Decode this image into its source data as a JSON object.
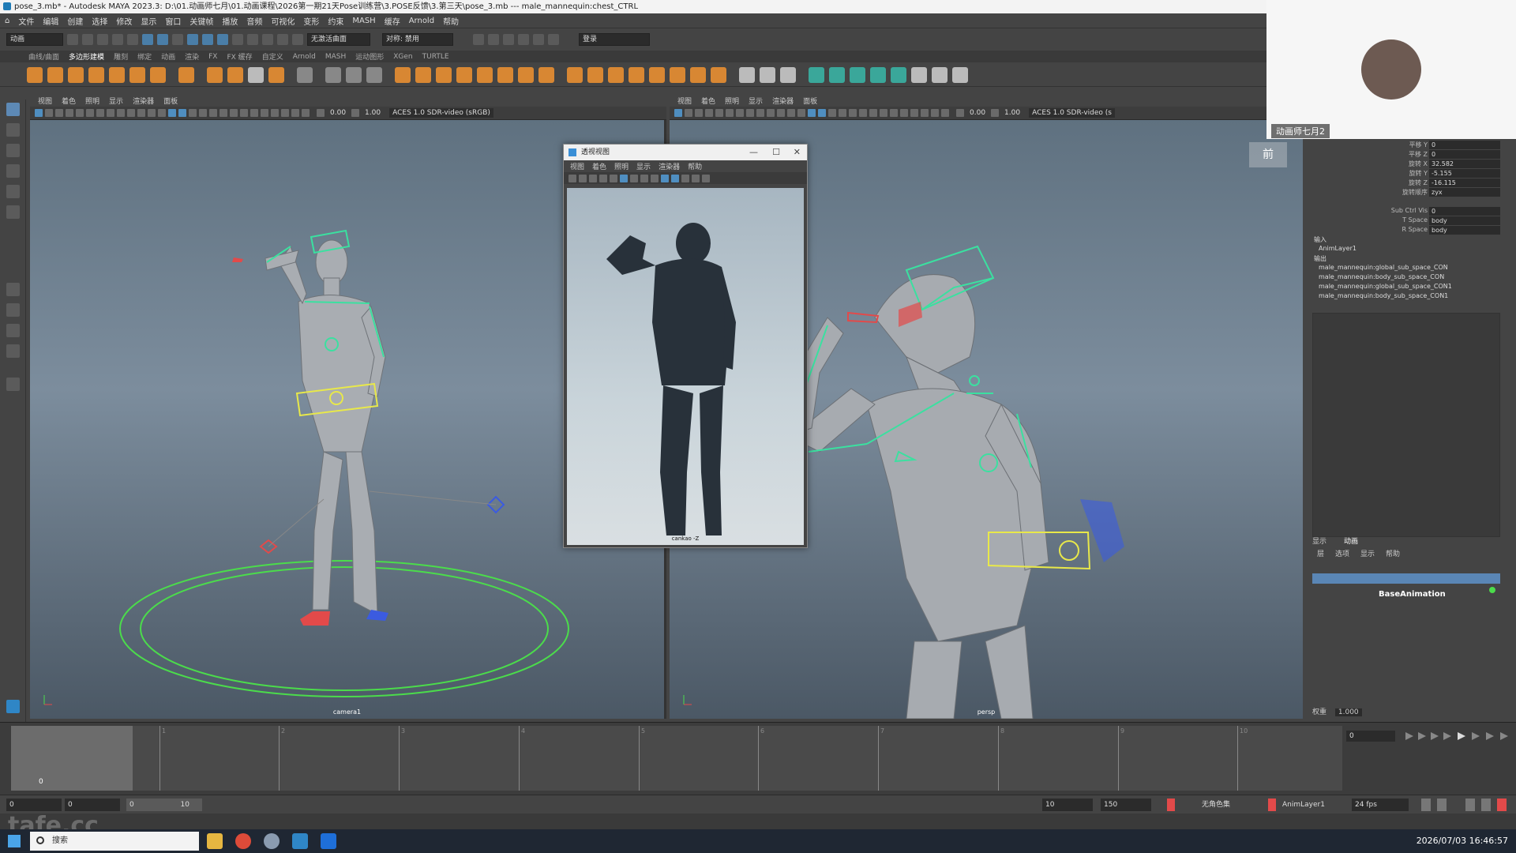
{
  "title_bar": {
    "text": "pose_3.mb* - Autodesk MAYA 2023.3: D:\\01.动画师七月\\01.动画课程\\2026第一期21天Pose训练营\\3.POSE反馈\\3.第三天\\pose_3.mb   ---   male_mannequin:chest_CTRL"
  },
  "menu": [
    "文件",
    "编辑",
    "创建",
    "选择",
    "修改",
    "显示",
    "窗口",
    "关键帧",
    "播放",
    "音频",
    "可视化",
    "变形",
    "约束",
    "MASH",
    "缓存",
    "Arnold",
    "帮助"
  ],
  "status_line": {
    "mode": "动画",
    "curve_label": "无激活曲面",
    "symmetry": "对称: 禁用",
    "login": "登录"
  },
  "shelf_tabs": [
    "曲线/曲面",
    "多边形建模",
    "雕刻",
    "绑定",
    "动画",
    "渲染",
    "FX",
    "FX 缓存",
    "自定义",
    "Arnold",
    "MASH",
    "运动图形",
    "XGen",
    "TURTLE"
  ],
  "shelf_active": "多边形建模",
  "viewport_menu": [
    "视图",
    "着色",
    "照明",
    "显示",
    "渲染器",
    "面板"
  ],
  "viewport_left": {
    "num1": "0.00",
    "num2": "1.00",
    "color_space": "ACES 1.0 SDR-video (sRGB)",
    "camera": "camera1"
  },
  "viewport_right": {
    "num1": "0.00",
    "num2": "1.00",
    "color_space": "ACES 1.0 SDR-video (s",
    "camera": "persp",
    "view_cube": "前"
  },
  "ref_window": {
    "title": "透视视图",
    "menu": [
      "视图",
      "着色",
      "照明",
      "显示",
      "渲染器",
      "帮助"
    ],
    "camera": "cankao -Z"
  },
  "webcam": {
    "name": "动画师七月2"
  },
  "channel_box": {
    "attrs": [
      {
        "label": "平移 Y",
        "value": "0"
      },
      {
        "label": "平移 Z",
        "value": "0"
      },
      {
        "label": "旋转 X",
        "value": "32.582"
      },
      {
        "label": "旋转 Y",
        "value": "-5.155"
      },
      {
        "label": "旋转 Z",
        "value": "-16.115"
      },
      {
        "label": "旋转顺序",
        "value": "zyx"
      },
      {
        "label": "Sub Ctrl Vis",
        "value": "0"
      },
      {
        "label": "T Space",
        "value": "body"
      },
      {
        "label": "R Space",
        "value": "body"
      }
    ],
    "inputs_label": "输入",
    "inputs": [
      "AnimLayer1"
    ],
    "outputs_label": "输出",
    "outputs": [
      "male_mannequin:global_sub_space_CON",
      "male_mannequin:body_sub_space_CON",
      "male_mannequin:global_sub_space_CON1",
      "male_mannequin:body_sub_space_CON1"
    ]
  },
  "layer_editor": {
    "tabs": [
      "显示",
      "动画"
    ],
    "menu": [
      "层",
      "选项",
      "显示",
      "帮助"
    ],
    "base_layer": "BaseAnimation",
    "weight_label": "权重",
    "weight_value": "1.000"
  },
  "timeline": {
    "ticks": [
      "0",
      "1",
      "2",
      "3",
      "4",
      "5",
      "6",
      "7",
      "8",
      "9",
      "10"
    ],
    "cursor_frame": "0",
    "current_frame": "0"
  },
  "range_bar": {
    "start": "0",
    "playback_start": "0",
    "range_left": "0",
    "range_right": "10",
    "end": "10",
    "anim_end": "150",
    "character_set": "无角色集",
    "anim_layer": "AnimLayer1",
    "fps": "24 fps"
  },
  "taskbar": {
    "search": "搜索",
    "clock": "2026/07/03 16:46:57"
  },
  "watermark": "tafe.cc"
}
